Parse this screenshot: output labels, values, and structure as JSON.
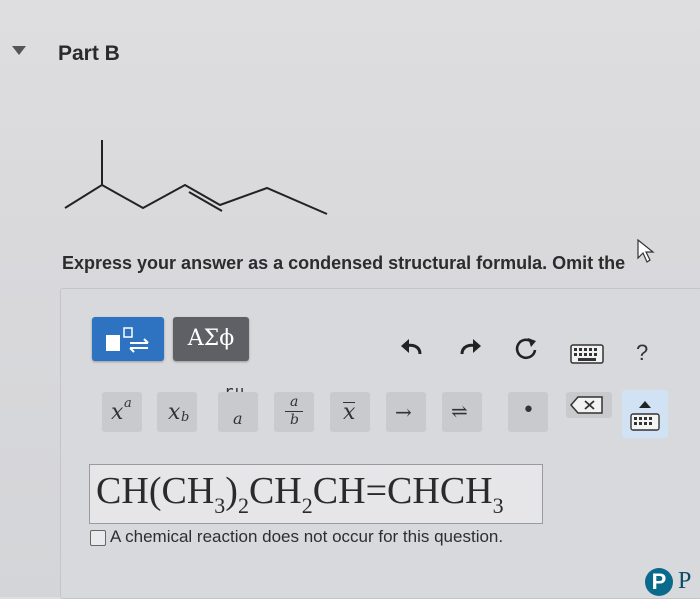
{
  "part": {
    "title": "Part B"
  },
  "instruction": "Express your answer as a condensed structural formula. Omit the",
  "toolbar": {
    "templates_icon": "templates-icon",
    "greek_label": "ΑΣϕ",
    "undo_icon": "undo-icon",
    "redo_icon": "redo-icon",
    "reset_icon": "reset-icon",
    "keyboard_icon": "keyboard-icon",
    "help_label": "?"
  },
  "keys": {
    "extra_label": "ru",
    "items": [
      {
        "name": "superscript-key",
        "label": "x^a"
      },
      {
        "name": "subscript-key",
        "label": "x_b"
      },
      {
        "name": "key-a",
        "label": "a"
      },
      {
        "name": "fraction-key",
        "label": "a/b"
      },
      {
        "name": "overline-key",
        "label": "x̅"
      },
      {
        "name": "arrow-key",
        "label": "→"
      },
      {
        "name": "equilibrium-key",
        "label": "⇌"
      },
      {
        "name": "dot-key",
        "label": "•"
      },
      {
        "name": "delete-key",
        "label": "⌫"
      },
      {
        "name": "keyboard-toggle-key",
        "label": "keyboard"
      }
    ]
  },
  "answer": {
    "formula": "CH(CH3)2CH2CH=CHCH3"
  },
  "no_reaction_label": "A chemical reaction does not occur for this question.",
  "logo_letter": "P",
  "logo_partial_text": "P",
  "colors": {
    "accent": "#2e73c2",
    "greek_button": "#5e6066",
    "logo": "#0a6a8c"
  }
}
